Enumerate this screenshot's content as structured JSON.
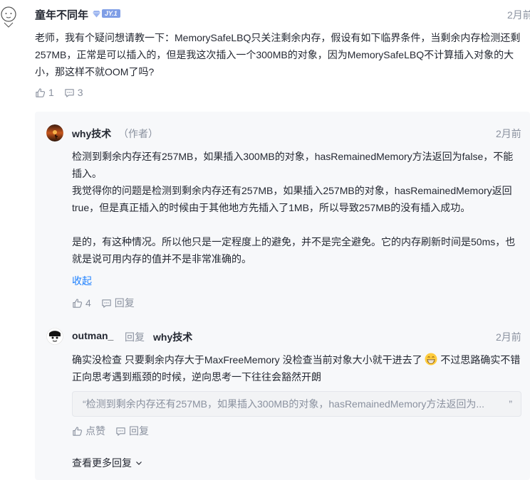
{
  "top_comment": {
    "author": "童年不同年",
    "level": "JY.1",
    "time": "2月前",
    "content": "老师，我有个疑问想请教一下：MemorySafeLBQ只关注剩余内存，假设有如下临界条件，当剩余内存检测还剩257MB，正常是可以插入的，但是我这次插入一个300MB的对象，因为MemorySafeLBQ不计算插入对象的大小，那这样不就OOM了吗?",
    "likes": "1",
    "comments": "3"
  },
  "reply1": {
    "author": "why技术",
    "tag": "（作者）",
    "time": "2月前",
    "para1": "检测到剩余内存还有257MB，如果插入300MB的对象，hasRemainedMemory方法返回为false，不能插入。",
    "para2": "我觉得你的问题是检测到剩余内存还有257MB，如果插入257MB的对象，hasRemainedMemory返回true，但是真正插入的时候由于其他地方先插入了1MB，所以导致257MB的没有插入成功。",
    "para3": "是的，有这种情况。所以他只是一定程度上的避免，并不是完全避免。它的内存刷新时间是50ms，也就是说可用内存的值并不是非常准确的。",
    "collapse_label": "收起",
    "likes": "4",
    "reply_label": "回复"
  },
  "reply2": {
    "author": "outman_",
    "reply_word": "回复",
    "reply_to": "why技术",
    "time": "2月前",
    "content_a": "确实没检查 只要剩余内存大于MaxFreeMemory 没检查当前对象大小就干进去了",
    "content_b": " 不过思路确实不错 正向思考遇到瓶颈的时候，逆向思考一下往往会豁然开朗",
    "quote": "“检测到剩余内存还有257MB，如果插入300MB的对象，hasRemainedMemory方法返回为...",
    "quote_close": "”",
    "like_label": "点赞",
    "reply_label": "回复"
  },
  "more_replies_label": "查看更多回复",
  "colors": {
    "link": "#1e80ff",
    "muted": "#8a919f",
    "text": "#252933",
    "reply_bg": "#f7f8fa"
  }
}
